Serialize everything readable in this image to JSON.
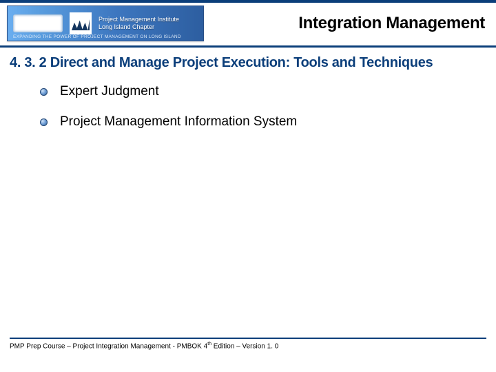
{
  "header": {
    "logo": {
      "org_line1": "Project Management Institute",
      "org_line2": "Long Island Chapter",
      "tagline": "EXPANDING THE POWER OF PROJECT MANAGEMENT ON LONG ISLAND"
    },
    "title": "Integration Management"
  },
  "section": {
    "number": "4. 3. 2",
    "heading": "Direct and Manage Project Execution: Tools and Techniques"
  },
  "bullets": [
    {
      "label": "Expert Judgment"
    },
    {
      "label": "Project Management Information System"
    }
  ],
  "footer": {
    "text_before_sup": "PMP Prep Course – Project Integration Management - PMBOK 4",
    "sup": "th",
    "text_after_sup": " Edition – Version 1. 0"
  }
}
